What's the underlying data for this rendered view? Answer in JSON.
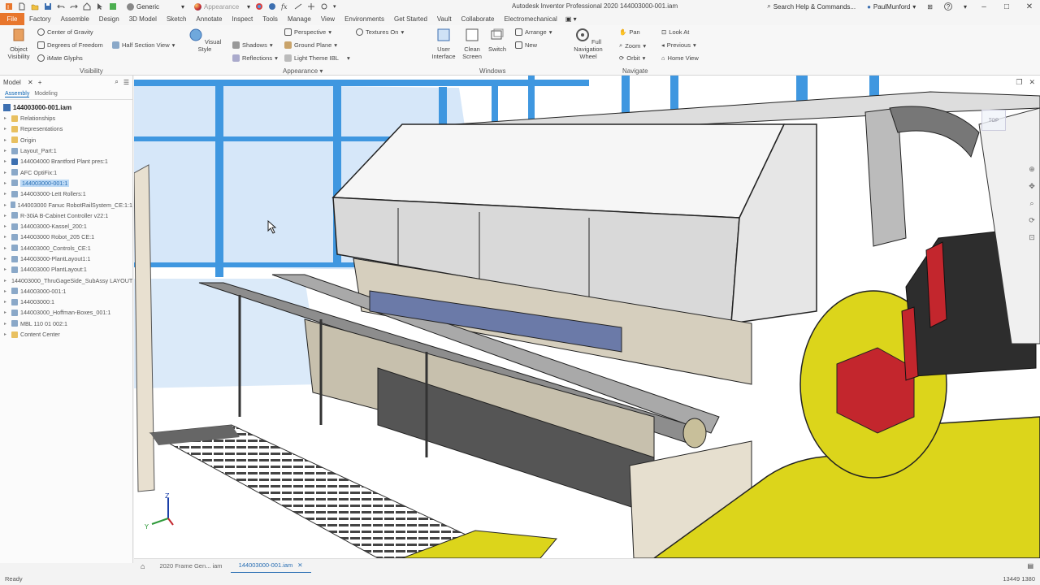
{
  "titlebar": {
    "title": "Autodesk Inventor Professional 2020   144003000-001.iam",
    "appearance_combo": "Generic",
    "material_combo": "Appearance",
    "search_placeholder": "Search Help & Commands...",
    "user": "PaulMunford"
  },
  "menu": {
    "file": "File",
    "items": [
      "Factory",
      "Assemble",
      "Design",
      "3D Model",
      "Sketch",
      "Annotate",
      "Inspect",
      "Tools",
      "Manage",
      "View",
      "Environments",
      "Get Started",
      "Vault",
      "Collaborate",
      "Electromechanical"
    ]
  },
  "ribbon": {
    "visibility": {
      "label": "Visibility",
      "object_visibility": "Object Visibility",
      "center_of_gravity": "Center of Gravity",
      "degrees_of_freedom": "Degrees of Freedom",
      "mate_glyphs": "iMate Glyphs",
      "half_section": "Half Section View"
    },
    "appearance": {
      "label": "Appearance",
      "visual_style": "Visual Style",
      "shadows": "Shadows",
      "reflections": "Reflections",
      "perspective": "Perspective",
      "ground_plane": "Ground Plane",
      "light_theme": "Light Theme IBL",
      "textures_on": "Textures On"
    },
    "windows": {
      "label": "Windows",
      "user_interface": "User Interface",
      "clean_screen": "Clean Screen",
      "switch": "Switch",
      "arrange": "Arrange",
      "new": "New"
    },
    "navigate": {
      "label": "Navigate",
      "full_nav_wheel": "Full Navigation Wheel",
      "pan": "Pan",
      "zoom": "Zoom",
      "orbit": "Orbit",
      "look_at": "Look At",
      "previous": "Previous",
      "home_view": "Home View"
    }
  },
  "browser": {
    "title": "Model",
    "tabs": [
      "Assembly",
      "Modeling"
    ],
    "root": "144003000-001.iam",
    "items": [
      {
        "label": "Relationships",
        "icon": "folder"
      },
      {
        "label": "Representations",
        "icon": "folder"
      },
      {
        "label": "Origin",
        "icon": "folder"
      },
      {
        "label": "Layout_Part:1",
        "icon": "part"
      },
      {
        "label": "144004000 Brantford Plant pres:1",
        "icon": "assembly"
      },
      {
        "label": "AFC OptiFix:1",
        "icon": "part"
      },
      {
        "label": "144003000-001:1",
        "icon": "part",
        "selected": true
      },
      {
        "label": "144003000-Lett Rollers:1",
        "icon": "part"
      },
      {
        "label": "144003000 Fanuc RobotRailSystem_CE:1:1",
        "icon": "part"
      },
      {
        "label": "R-30iA B-Cabinet Controller v22:1",
        "icon": "part"
      },
      {
        "label": "144003000-Kassel_200:1",
        "icon": "part"
      },
      {
        "label": "144003000 Robot_205 CE:1",
        "icon": "part"
      },
      {
        "label": "144003000_Controls_CE:1",
        "icon": "part"
      },
      {
        "label": "144003000-PlantLayout1:1",
        "icon": "part"
      },
      {
        "label": "144003000 PlantLayout:1",
        "icon": "part"
      },
      {
        "label": "144003000_ThruGageSide_SubAssy LAYOUT",
        "icon": "part"
      },
      {
        "label": "144003000-001:1",
        "icon": "part"
      },
      {
        "label": "144003000:1",
        "icon": "part"
      },
      {
        "label": "144003000_Hoffman-Boxes_001:1",
        "icon": "part"
      },
      {
        "label": "MBL 110 01 002:1",
        "icon": "part"
      },
      {
        "label": "Content Center",
        "icon": "folder"
      }
    ]
  },
  "doc_tabs": [
    {
      "label": "2020 Frame Gen... iam",
      "active": false
    },
    {
      "label": "144003000-001.iam",
      "active": true
    }
  ],
  "status": {
    "left": "Ready",
    "right": "13449   1380"
  },
  "viewcube": {
    "label": "TOP"
  },
  "colors": {
    "file_menu": "#e8762c",
    "selection_blue": "#2a6fb4",
    "glass_blue": "#3f97e0",
    "robot_yellow": "#dcd51b",
    "robot_red": "#c3262d"
  }
}
